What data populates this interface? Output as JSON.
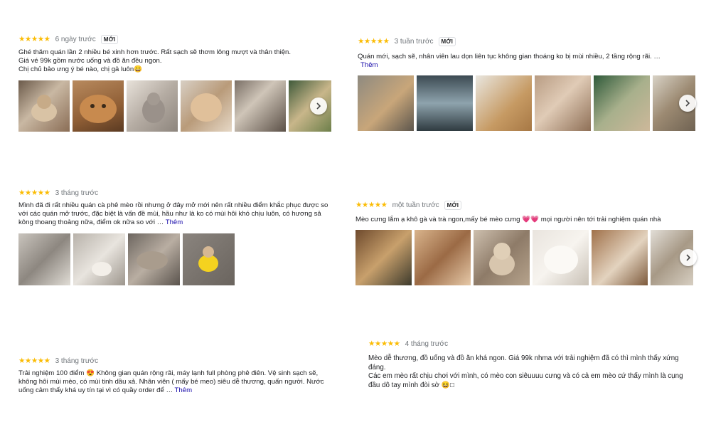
{
  "reviews": [
    {
      "stars": "★★★★★",
      "time": "6 ngày trước",
      "badge": "MỚI",
      "lines": [
        "Ghé thăm quán lần 2 nhiều bé xinh hơn trước. Rất sạch sẽ thơm lông mượt và thân thiện.",
        "Giá vé 99k gồm nước uống và đồ ăn đều ngon.",
        "Chị chủ bảo ưng ý bé nào, chị gả luôn😄"
      ],
      "more": "",
      "photos": [
        "cat-cafe-interior",
        "orange-cat-closeup",
        "grey-cat",
        "cream-cat",
        "cafe-seating",
        "cafe-counter"
      ],
      "has_next": true
    },
    {
      "stars": "★★★★★",
      "time": "3 tuần trước",
      "badge": "MỚI",
      "lines": [
        "Quán mới, sạch sẽ, nhân viên lau dọn liên tục không gian thoáng ko bị mùi nhiều, 2 tầng rộng rãi. …"
      ],
      "more": "Thêm",
      "photos": [
        "cat-on-table",
        "cafe-entrance",
        "wooden-floor-room",
        "sleeping-cat",
        "christmas-tree-cat",
        "cats-on-bench"
      ],
      "has_next": true
    },
    {
      "stars": "★★★★★",
      "time": "3 tháng trước",
      "badge": "",
      "lines": [
        "Mình đã đi rất nhiều quán cà phê mèo rồi nhưng ở đây mở mới nên rất nhiều điểm khắc phục được so",
        "với các quán mở trước, đặc biệt là vấn đề mùi, hầu như là ko có mùi hôi khó chịu luôn, có hương sả",
        "kông thoang thoảng nữa, điểm ok nữa so với …"
      ],
      "more": "Thêm",
      "photos": [
        "cat-room",
        "white-cat-playing",
        "tabby-cat-lying",
        "cat-in-yellow-outfit"
      ],
      "has_next": false
    },
    {
      "stars": "★★★★★",
      "time": "một tuần trước",
      "badge": "MỚI",
      "lines": [
        "Mèo cưng lắm ạ khô gà và trà ngon,mấy bé mèo cưng 💗💗 mọi người nên tới trải nghiệm quán nhà"
      ],
      "more": "",
      "photos": [
        "jenga-drinks",
        "cat-held",
        "scottish-fold-cat",
        "white-fluffy-cat",
        "cat-on-shelf",
        "cafe-bright-room"
      ],
      "has_next": true
    },
    {
      "stars": "★★★★★",
      "time": "3 tháng trước",
      "badge": "",
      "lines": [
        "Trải nghiệm 100 điểm 😍 Không gian quán rộng rãi, máy lạnh full phòng phê điên. Vệ sinh sạch sẽ,",
        "không hôi mùi mèo, có mùi tinh dầu xả. Nhân viên ( mấy bé meo) siêu dễ thương, quấn người. Nước",
        "uống cảm thấy khá uy tín tại vì có quầy order để …"
      ],
      "more": "Thêm",
      "photos": [],
      "has_next": false
    },
    {
      "stars": "★★★★★",
      "time": "4 tháng trước",
      "badge": "",
      "lines": [
        "Mèo dễ thương, đồ uống và đồ ăn khá ngon. Giá 99k nhma với trải nghiệm đã có thì mình thấy xứng",
        "đáng.",
        "Các em mèo rất chịu chơi với mình, có mèo con siêuuuu cưng và có cả em mèo cứ thấy mình là cụng",
        "đầu dô tay mình đòi sờ 😆□"
      ],
      "more": "",
      "photos": [],
      "has_next": false
    }
  ],
  "icons": {
    "star": "star-icon",
    "next": "chevron-right-icon"
  },
  "colors": {
    "star": "#fbbc04",
    "link": "#1a0dab",
    "muted": "#70757a"
  }
}
